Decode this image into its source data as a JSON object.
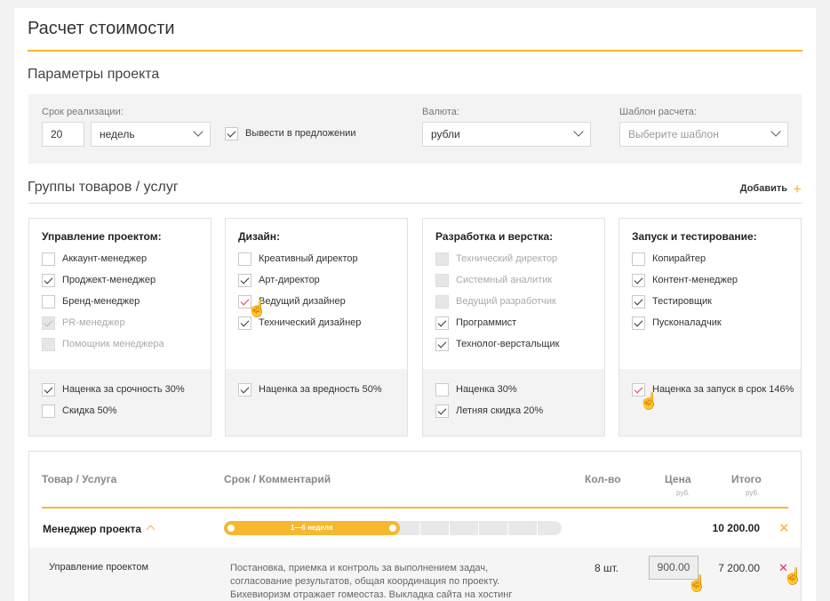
{
  "page": {
    "title": "Расчет стоимости"
  },
  "params": {
    "section_title": "Параметры проекта",
    "term_label": "Срок реализации:",
    "term_value": "20",
    "term_unit": "недель",
    "show_in_offer": "Вывести в предложении",
    "currency_label": "Валюта:",
    "currency_value": "рубли",
    "template_label": "Шаблон расчета:",
    "template_placeholder": "Выберите шаблон"
  },
  "groups": {
    "section_title": "Группы товаров / услуг",
    "add_label": "Добавить",
    "cards": [
      {
        "title": "Управление проектом:",
        "items": [
          {
            "label": "Аккаунт-менеджер",
            "checked": false,
            "disabled": false
          },
          {
            "label": "Проджект-менеджер",
            "checked": true,
            "disabled": false
          },
          {
            "label": "Бренд-менеджер",
            "checked": false,
            "disabled": false
          },
          {
            "label": "PR-менеджер",
            "checked": true,
            "disabled": true
          },
          {
            "label": "Помощник менеджера",
            "checked": false,
            "disabled": true
          }
        ],
        "extras": [
          {
            "label": "Наценка за срочность 30%",
            "checked": true
          },
          {
            "label": "Скидка 50%",
            "checked": false
          }
        ]
      },
      {
        "title": "Дизайн:",
        "items": [
          {
            "label": "Креативный директор",
            "checked": false,
            "disabled": false
          },
          {
            "label": "Арт-директор",
            "checked": true,
            "disabled": false
          },
          {
            "label": "Ведущий дизайнер",
            "checked": true,
            "disabled": false,
            "red": true
          },
          {
            "label": "Технический дизайнер",
            "checked": true,
            "disabled": false
          }
        ],
        "extras": [
          {
            "label": "Наценка за вредность 50%",
            "checked": true
          }
        ]
      },
      {
        "title": "Разработка и верстка:",
        "items": [
          {
            "label": "Технический директор",
            "checked": false,
            "disabled": true
          },
          {
            "label": "Системный аналитик",
            "checked": false,
            "disabled": true
          },
          {
            "label": "Ведущий разработчик",
            "checked": false,
            "disabled": true
          },
          {
            "label": "Программист",
            "checked": true,
            "disabled": false
          },
          {
            "label": "Технолог-верстальщик",
            "checked": true,
            "disabled": false
          }
        ],
        "extras": [
          {
            "label": "Наценка 30%",
            "checked": false
          },
          {
            "label": "Летняя скидка 20%",
            "checked": true
          }
        ]
      },
      {
        "title": "Запуск и тестирование:",
        "items": [
          {
            "label": "Копирайтер",
            "checked": false,
            "disabled": false
          },
          {
            "label": "Контент-менеджер",
            "checked": true,
            "disabled": false
          },
          {
            "label": "Тестировщик",
            "checked": true,
            "disabled": false
          },
          {
            "label": "Пусконаладчик",
            "checked": true,
            "disabled": false
          }
        ],
        "extras": [
          {
            "label": "Наценка за запуск в срок 146%",
            "checked": true,
            "red": true
          }
        ]
      }
    ]
  },
  "table": {
    "headers": {
      "item": "Товар / Услуга",
      "term": "Срок / Комментарий",
      "qty": "Кол-во",
      "price": "Цена",
      "price_unit": "руб.",
      "total": "Итого",
      "total_unit": "руб."
    },
    "group": {
      "name": "Менеджер проекта",
      "timeline_label": "1—6 неделя",
      "timeline_fill_fraction": 0.52,
      "total": "10 200.00"
    },
    "row": {
      "name": "Управление проектом",
      "comment": "Постановка, приемка и контроль за выполнением задач, согласование результатов, общая координация по проекту. Бихевиоризм отражает гомеостаз. Выкладка сайта на хостинг",
      "qty": "8 шт.",
      "price": "900.00",
      "total": "7 200.00"
    }
  },
  "colors": {
    "accent": "#f5b82e",
    "danger": "#e33355"
  }
}
